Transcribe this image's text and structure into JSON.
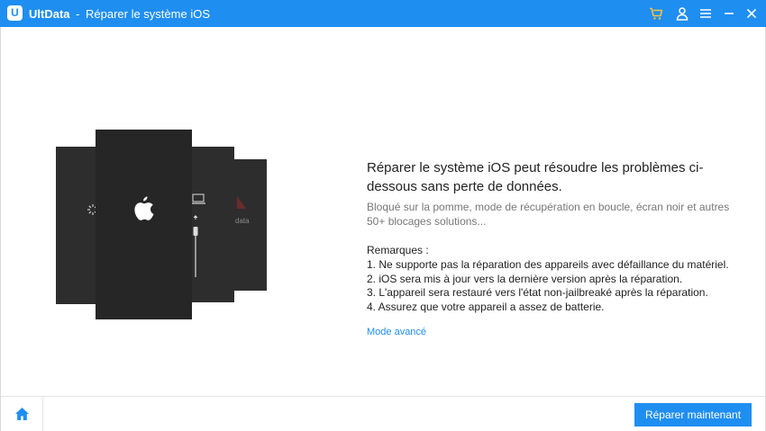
{
  "titlebar": {
    "logo_letter": "U",
    "app_name": "UltData",
    "separator": "-",
    "window_title": "Réparer le système iOS",
    "icons": [
      "cart-icon",
      "user-icon",
      "menu-icon",
      "minimize-icon",
      "close-icon"
    ]
  },
  "illustration": {
    "side_label": "data"
  },
  "main": {
    "heading": "Réparer le système iOS peut résoudre les problèmes ci-dessous sans perte de données.",
    "description": "Bloqué sur la pomme, mode de récupération en boucle, écran noir et autres 50+ blocages solutions...",
    "notes_title": "Remarques :",
    "notes": [
      "1. Ne supporte pas la réparation des appareils avec défaillance du matériel.",
      "2. iOS sera mis à jour vers la dernière version après la réparation.",
      "3. L'appareil sera restauré vers l'état non-jailbreaké après la réparation.",
      "4. Assurez que votre appareil a assez de batterie."
    ],
    "advanced_link": "Mode avancé"
  },
  "footer": {
    "home_icon": "home-icon",
    "repair_button": "Réparer maintenant"
  },
  "colors": {
    "accent": "#1f8ef1",
    "phone": "#2d2d2d"
  }
}
